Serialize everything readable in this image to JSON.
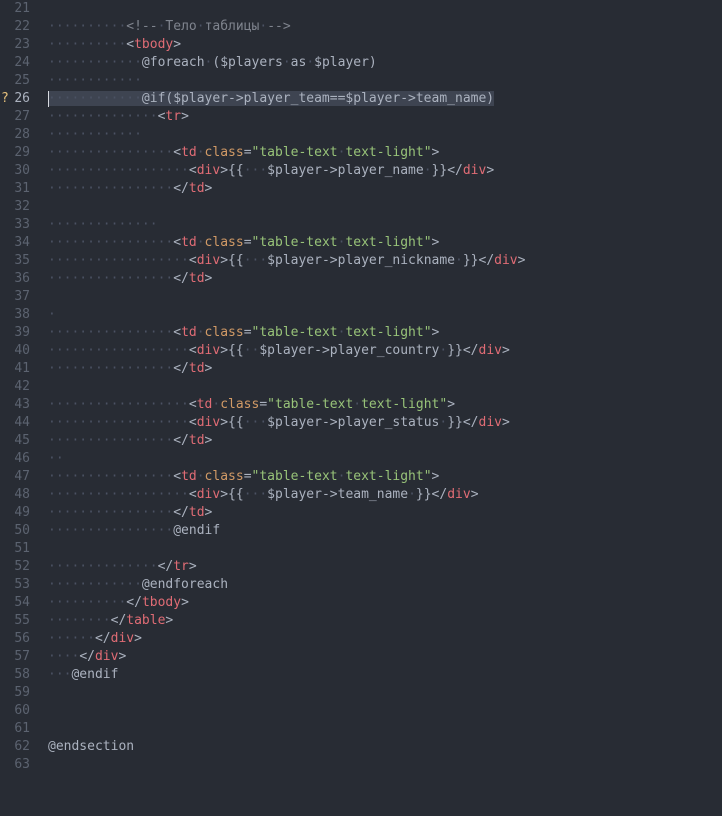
{
  "editor": {
    "active_line": 26,
    "gutter_marker": "?",
    "lines": [
      {
        "num": "21",
        "segs": []
      },
      {
        "num": "22",
        "segs": [
          {
            "t": "··········",
            "k": "ws"
          },
          {
            "t": "<!--",
            "k": "cmt"
          },
          {
            "t": "·",
            "k": "ws"
          },
          {
            "t": "Тело",
            "k": "cmt"
          },
          {
            "t": "·",
            "k": "ws"
          },
          {
            "t": "таблицы",
            "k": "cmt"
          },
          {
            "t": "·",
            "k": "ws"
          },
          {
            "t": "-->",
            "k": "cmt"
          }
        ]
      },
      {
        "num": "23",
        "segs": [
          {
            "t": "··········",
            "k": "ws"
          },
          {
            "t": "<",
            "k": "txt"
          },
          {
            "t": "tbody",
            "k": "tag"
          },
          {
            "t": ">",
            "k": "txt"
          }
        ]
      },
      {
        "num": "24",
        "segs": [
          {
            "t": "············",
            "k": "ws"
          },
          {
            "t": "@foreach",
            "k": "txt"
          },
          {
            "t": "·",
            "k": "ws"
          },
          {
            "t": "($players",
            "k": "txt"
          },
          {
            "t": "·",
            "k": "ws"
          },
          {
            "t": "as",
            "k": "txt"
          },
          {
            "t": "·",
            "k": "ws"
          },
          {
            "t": "$player)",
            "k": "txt"
          }
        ]
      },
      {
        "num": "25",
        "segs": [
          {
            "t": "············",
            "k": "ws"
          }
        ]
      },
      {
        "num": "26",
        "segs": [
          {
            "t": "············",
            "k": "ws"
          },
          {
            "t": "@if($player->player_team==$player->team_name)",
            "k": "txt"
          }
        ]
      },
      {
        "num": "27",
        "segs": [
          {
            "t": "··············",
            "k": "ws"
          },
          {
            "t": "<",
            "k": "txt"
          },
          {
            "t": "tr",
            "k": "tag"
          },
          {
            "t": ">",
            "k": "txt"
          }
        ]
      },
      {
        "num": "28",
        "segs": [
          {
            "t": "············",
            "k": "ws"
          }
        ]
      },
      {
        "num": "29",
        "segs": [
          {
            "t": "················",
            "k": "ws"
          },
          {
            "t": "<",
            "k": "txt"
          },
          {
            "t": "td",
            "k": "tag"
          },
          {
            "t": "·",
            "k": "ws"
          },
          {
            "t": "class",
            "k": "attr"
          },
          {
            "t": "=",
            "k": "txt"
          },
          {
            "t": "\"table-text",
            "k": "str"
          },
          {
            "t": "·",
            "k": "ws"
          },
          {
            "t": "text-light\"",
            "k": "str"
          },
          {
            "t": ">",
            "k": "txt"
          }
        ]
      },
      {
        "num": "30",
        "segs": [
          {
            "t": "··················",
            "k": "ws"
          },
          {
            "t": "<",
            "k": "txt"
          },
          {
            "t": "div",
            "k": "tag"
          },
          {
            "t": ">{{",
            "k": "txt"
          },
          {
            "t": "···",
            "k": "ws"
          },
          {
            "t": "$player->player_name",
            "k": "txt"
          },
          {
            "t": "·",
            "k": "ws"
          },
          {
            "t": "}}</",
            "k": "txt"
          },
          {
            "t": "div",
            "k": "tag"
          },
          {
            "t": ">",
            "k": "txt"
          }
        ]
      },
      {
        "num": "31",
        "segs": [
          {
            "t": "················",
            "k": "ws"
          },
          {
            "t": "</",
            "k": "txt"
          },
          {
            "t": "td",
            "k": "tag"
          },
          {
            "t": ">",
            "k": "txt"
          }
        ]
      },
      {
        "num": "32",
        "segs": []
      },
      {
        "num": "33",
        "segs": [
          {
            "t": "··············",
            "k": "ws"
          }
        ]
      },
      {
        "num": "34",
        "segs": [
          {
            "t": "················",
            "k": "ws"
          },
          {
            "t": "<",
            "k": "txt"
          },
          {
            "t": "td",
            "k": "tag"
          },
          {
            "t": "·",
            "k": "ws"
          },
          {
            "t": "class",
            "k": "attr"
          },
          {
            "t": "=",
            "k": "txt"
          },
          {
            "t": "\"table-text",
            "k": "str"
          },
          {
            "t": "·",
            "k": "ws"
          },
          {
            "t": "text-light\"",
            "k": "str"
          },
          {
            "t": ">",
            "k": "txt"
          }
        ]
      },
      {
        "num": "35",
        "segs": [
          {
            "t": "··················",
            "k": "ws"
          },
          {
            "t": "<",
            "k": "txt"
          },
          {
            "t": "div",
            "k": "tag"
          },
          {
            "t": ">{{",
            "k": "txt"
          },
          {
            "t": "···",
            "k": "ws"
          },
          {
            "t": "$player->player_nickname",
            "k": "txt"
          },
          {
            "t": "·",
            "k": "ws"
          },
          {
            "t": "}}</",
            "k": "txt"
          },
          {
            "t": "div",
            "k": "tag"
          },
          {
            "t": ">",
            "k": "txt"
          }
        ]
      },
      {
        "num": "36",
        "segs": [
          {
            "t": "················",
            "k": "ws"
          },
          {
            "t": "</",
            "k": "txt"
          },
          {
            "t": "td",
            "k": "tag"
          },
          {
            "t": ">",
            "k": "txt"
          }
        ]
      },
      {
        "num": "37",
        "segs": []
      },
      {
        "num": "38",
        "segs": [
          {
            "t": "·",
            "k": "ws"
          }
        ]
      },
      {
        "num": "39",
        "segs": [
          {
            "t": "················",
            "k": "ws"
          },
          {
            "t": "<",
            "k": "txt"
          },
          {
            "t": "td",
            "k": "tag"
          },
          {
            "t": "·",
            "k": "ws"
          },
          {
            "t": "class",
            "k": "attr"
          },
          {
            "t": "=",
            "k": "txt"
          },
          {
            "t": "\"table-text",
            "k": "str"
          },
          {
            "t": "·",
            "k": "ws"
          },
          {
            "t": "text-light\"",
            "k": "str"
          },
          {
            "t": ">",
            "k": "txt"
          }
        ]
      },
      {
        "num": "40",
        "segs": [
          {
            "t": "··················",
            "k": "ws"
          },
          {
            "t": "<",
            "k": "txt"
          },
          {
            "t": "div",
            "k": "tag"
          },
          {
            "t": ">{{",
            "k": "txt"
          },
          {
            "t": "··",
            "k": "ws"
          },
          {
            "t": "$player->player_country",
            "k": "txt"
          },
          {
            "t": "·",
            "k": "ws"
          },
          {
            "t": "}}</",
            "k": "txt"
          },
          {
            "t": "div",
            "k": "tag"
          },
          {
            "t": ">",
            "k": "txt"
          }
        ]
      },
      {
        "num": "41",
        "segs": [
          {
            "t": "················",
            "k": "ws"
          },
          {
            "t": "</",
            "k": "txt"
          },
          {
            "t": "td",
            "k": "tag"
          },
          {
            "t": ">",
            "k": "txt"
          }
        ]
      },
      {
        "num": "42",
        "segs": []
      },
      {
        "num": "43",
        "segs": [
          {
            "t": "··················",
            "k": "ws"
          },
          {
            "t": "<",
            "k": "txt"
          },
          {
            "t": "td",
            "k": "tag"
          },
          {
            "t": "·",
            "k": "ws"
          },
          {
            "t": "class",
            "k": "attr"
          },
          {
            "t": "=",
            "k": "txt"
          },
          {
            "t": "\"table-text",
            "k": "str"
          },
          {
            "t": "·",
            "k": "ws"
          },
          {
            "t": "text-light\"",
            "k": "str"
          },
          {
            "t": ">",
            "k": "txt"
          }
        ]
      },
      {
        "num": "44",
        "segs": [
          {
            "t": "··················",
            "k": "ws"
          },
          {
            "t": "<",
            "k": "txt"
          },
          {
            "t": "div",
            "k": "tag"
          },
          {
            "t": ">{{",
            "k": "txt"
          },
          {
            "t": "···",
            "k": "ws"
          },
          {
            "t": "$player->player_status",
            "k": "txt"
          },
          {
            "t": "·",
            "k": "ws"
          },
          {
            "t": "}}</",
            "k": "txt"
          },
          {
            "t": "div",
            "k": "tag"
          },
          {
            "t": ">",
            "k": "txt"
          }
        ]
      },
      {
        "num": "45",
        "segs": [
          {
            "t": "················",
            "k": "ws"
          },
          {
            "t": "</",
            "k": "txt"
          },
          {
            "t": "td",
            "k": "tag"
          },
          {
            "t": ">",
            "k": "txt"
          }
        ]
      },
      {
        "num": "46",
        "segs": [
          {
            "t": "··",
            "k": "ws"
          }
        ]
      },
      {
        "num": "47",
        "segs": [
          {
            "t": "················",
            "k": "ws"
          },
          {
            "t": "<",
            "k": "txt"
          },
          {
            "t": "td",
            "k": "tag"
          },
          {
            "t": "·",
            "k": "ws"
          },
          {
            "t": "class",
            "k": "attr"
          },
          {
            "t": "=",
            "k": "txt"
          },
          {
            "t": "\"table-text",
            "k": "str"
          },
          {
            "t": "·",
            "k": "ws"
          },
          {
            "t": "text-light\"",
            "k": "str"
          },
          {
            "t": ">",
            "k": "txt"
          }
        ]
      },
      {
        "num": "48",
        "segs": [
          {
            "t": "··················",
            "k": "ws"
          },
          {
            "t": "<",
            "k": "txt"
          },
          {
            "t": "div",
            "k": "tag"
          },
          {
            "t": ">{{",
            "k": "txt"
          },
          {
            "t": "···",
            "k": "ws"
          },
          {
            "t": "$player->team_name",
            "k": "txt"
          },
          {
            "t": "·",
            "k": "ws"
          },
          {
            "t": "}}</",
            "k": "txt"
          },
          {
            "t": "div",
            "k": "tag"
          },
          {
            "t": ">",
            "k": "txt"
          }
        ]
      },
      {
        "num": "49",
        "segs": [
          {
            "t": "················",
            "k": "ws"
          },
          {
            "t": "</",
            "k": "txt"
          },
          {
            "t": "td",
            "k": "tag"
          },
          {
            "t": ">",
            "k": "txt"
          }
        ]
      },
      {
        "num": "50",
        "segs": [
          {
            "t": "················",
            "k": "ws"
          },
          {
            "t": "@endif",
            "k": "txt"
          }
        ]
      },
      {
        "num": "51",
        "segs": []
      },
      {
        "num": "52",
        "segs": [
          {
            "t": "··············",
            "k": "ws"
          },
          {
            "t": "</",
            "k": "txt"
          },
          {
            "t": "tr",
            "k": "tag"
          },
          {
            "t": ">",
            "k": "txt"
          }
        ]
      },
      {
        "num": "53",
        "segs": [
          {
            "t": "············",
            "k": "ws"
          },
          {
            "t": "@endforeach",
            "k": "txt"
          }
        ]
      },
      {
        "num": "54",
        "segs": [
          {
            "t": "··········",
            "k": "ws"
          },
          {
            "t": "</",
            "k": "txt"
          },
          {
            "t": "tbody",
            "k": "tag"
          },
          {
            "t": ">",
            "k": "txt"
          }
        ]
      },
      {
        "num": "55",
        "segs": [
          {
            "t": "········",
            "k": "ws"
          },
          {
            "t": "</",
            "k": "txt"
          },
          {
            "t": "table",
            "k": "tag"
          },
          {
            "t": ">",
            "k": "txt"
          }
        ]
      },
      {
        "num": "56",
        "segs": [
          {
            "t": "······",
            "k": "ws"
          },
          {
            "t": "</",
            "k": "txt"
          },
          {
            "t": "div",
            "k": "tag"
          },
          {
            "t": ">",
            "k": "txt"
          }
        ]
      },
      {
        "num": "57",
        "segs": [
          {
            "t": "····",
            "k": "ws"
          },
          {
            "t": "</",
            "k": "txt"
          },
          {
            "t": "div",
            "k": "tag"
          },
          {
            "t": ">",
            "k": "txt"
          }
        ]
      },
      {
        "num": "58",
        "segs": [
          {
            "t": "···",
            "k": "ws"
          },
          {
            "t": "@endif",
            "k": "txt"
          }
        ]
      },
      {
        "num": "59",
        "segs": []
      },
      {
        "num": "60",
        "segs": []
      },
      {
        "num": "61",
        "segs": []
      },
      {
        "num": "62",
        "segs": [
          {
            "t": "@endsection",
            "k": "txt"
          }
        ]
      },
      {
        "num": "63",
        "segs": []
      }
    ]
  }
}
